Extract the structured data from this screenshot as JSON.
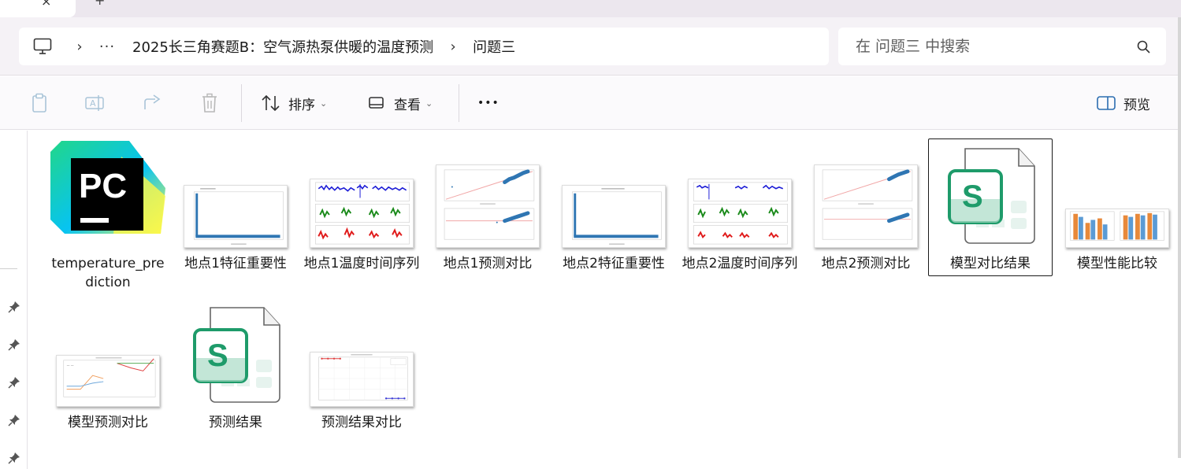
{
  "tabbar": {
    "close_glyph": "×",
    "new_glyph": "+"
  },
  "breadcrumb": {
    "sep": "›",
    "more": "···",
    "items": [
      "2025长三角赛题B：空气源热泵供暖的温度预测",
      "问题三"
    ]
  },
  "search": {
    "placeholder": "在 问题三 中搜索"
  },
  "toolbar": {
    "sort_label": "排序",
    "view_label": "查看",
    "more_label": "•••",
    "preview_label": "预览"
  },
  "files": [
    {
      "name": "temperature_prediction",
      "kind": "pycharm"
    },
    {
      "name": "地点1特征重要性",
      "kind": "bar-importance"
    },
    {
      "name": "地点1温度时间序列",
      "kind": "timeseries"
    },
    {
      "name": "地点1预测对比",
      "kind": "scatter"
    },
    {
      "name": "地点2特征重要性",
      "kind": "bar-importance"
    },
    {
      "name": "地点2温度时间序列",
      "kind": "timeseries"
    },
    {
      "name": "地点2预测对比",
      "kind": "scatter"
    },
    {
      "name": "模型对比结果",
      "kind": "sheet",
      "selected": true
    },
    {
      "name": "模型性能比较",
      "kind": "bars"
    },
    {
      "name": "模型预测对比",
      "kind": "lines"
    },
    {
      "name": "预测结果",
      "kind": "sheet"
    },
    {
      "name": "预测结果对比",
      "kind": "points"
    }
  ],
  "pycharm_logo_text": "PC",
  "sheet_letter": "S",
  "colors": {
    "sheet_green": "#1e9b6a",
    "accent_blue": "#2b6cb0",
    "pycharm_green": "#21d789"
  }
}
